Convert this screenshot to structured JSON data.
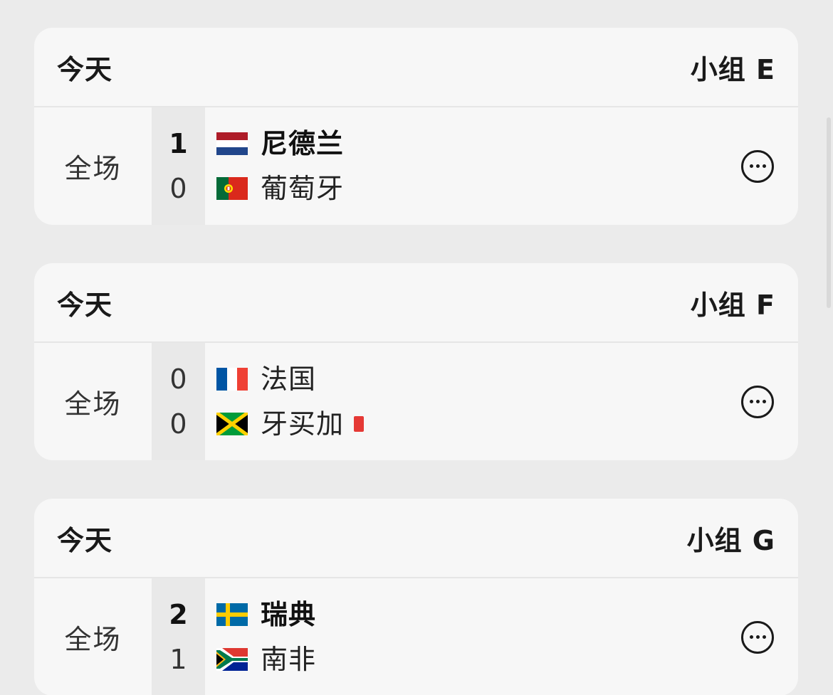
{
  "matches": [
    {
      "day": "今天",
      "group": "小组 E",
      "status": "全场",
      "home": {
        "name": "尼德兰",
        "score": "1",
        "flag": "netherlands-flag-icon",
        "winner": true,
        "red_cards": 0
      },
      "away": {
        "name": "葡萄牙",
        "score": "0",
        "flag": "portugal-flag-icon",
        "winner": false,
        "red_cards": 0
      }
    },
    {
      "day": "今天",
      "group": "小组 F",
      "status": "全场",
      "home": {
        "name": "法国",
        "score": "0",
        "flag": "france-flag-icon",
        "winner": false,
        "red_cards": 0
      },
      "away": {
        "name": "牙买加",
        "score": "0",
        "flag": "jamaica-flag-icon",
        "winner": false,
        "red_cards": 1
      }
    },
    {
      "day": "今天",
      "group": "小组 G",
      "status": "全场",
      "home": {
        "name": "瑞典",
        "score": "2",
        "flag": "sweden-flag-icon",
        "winner": true,
        "red_cards": 0
      },
      "away": {
        "name": "南非",
        "score": "1",
        "flag": "south-africa-flag-icon",
        "winner": false,
        "red_cards": 0
      }
    }
  ],
  "colors": {
    "background": "#ebebeb",
    "card": "#f7f7f7",
    "score_column": "#e9e9e9",
    "red_card": "#e53935"
  },
  "more_icon": "more-horizontal-circle-icon"
}
